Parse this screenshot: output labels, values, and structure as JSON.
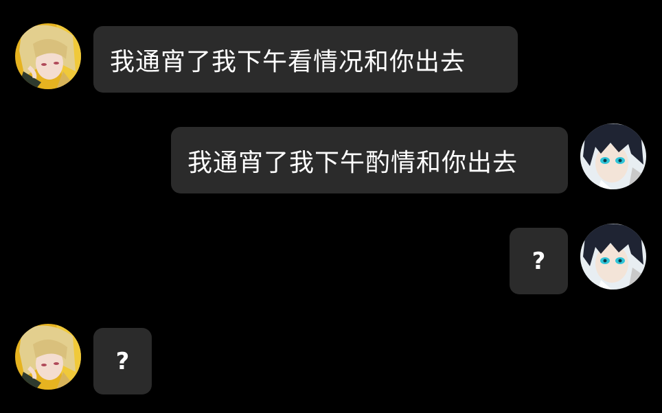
{
  "conversation": {
    "messages": [
      {
        "sender": "blonde-character",
        "side": "left",
        "text": "我通宵了我下午看情况和你出去"
      },
      {
        "sender": "dark-hair-character",
        "side": "right",
        "text": "我通宵了我下午酌情和你出去"
      },
      {
        "sender": "dark-hair-character",
        "side": "right",
        "text": "?"
      },
      {
        "sender": "blonde-character",
        "side": "left",
        "text": "?"
      }
    ]
  },
  "avatars": {
    "blonde": {
      "icon": "blonde-anime-avatar",
      "hair_color": "#e3cf8e",
      "background_color": "#e6b320"
    },
    "dark": {
      "icon": "dark-hair-anime-avatar",
      "hair_color": "#1f2433",
      "eye_color": "#2fc4d8"
    }
  },
  "colors": {
    "background": "#000000",
    "bubble": "#2b2b2b",
    "text": "#ffffff"
  }
}
